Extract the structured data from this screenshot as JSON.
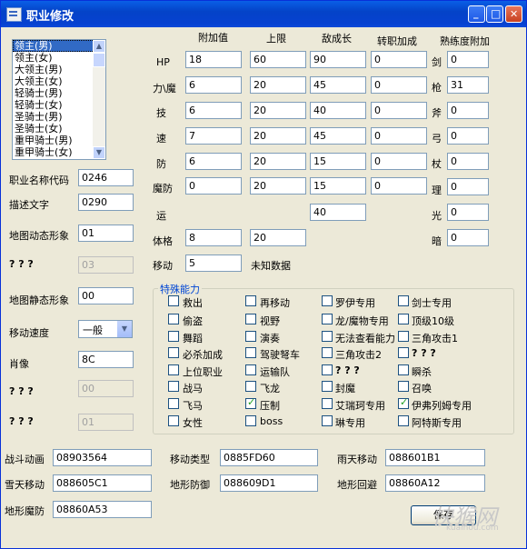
{
  "window": {
    "title": "职业修改",
    "minimize_glyph": "_",
    "maximize_glyph": "□",
    "close_glyph": "✕"
  },
  "class_list": [
    "领主(男)",
    "领主(女)",
    "大领主(男)",
    "大领主(女)",
    "轻骑士(男)",
    "轻骑士(女)",
    "圣骑士(男)",
    "圣骑士(女)",
    "重甲骑士(男)",
    "重甲骑士(女)"
  ],
  "left_fields": {
    "class_code": {
      "label": "职业名称代码",
      "value": "0246"
    },
    "desc_text": {
      "label": "描述文字",
      "value": "0290"
    },
    "map_anim": {
      "label": "地图动态形象",
      "value": "01"
    },
    "unknown1": {
      "label": "? ? ?",
      "value": "03"
    },
    "map_static": {
      "label": "地图静态形象",
      "value": "00"
    },
    "move_speed": {
      "label": "移动速度",
      "value": "一般"
    },
    "portrait": {
      "label": "肖像",
      "value": "8C"
    },
    "unknown2": {
      "label": "? ? ?",
      "value": "00"
    },
    "unknown3": {
      "label": "? ? ?",
      "value": "01"
    }
  },
  "stats": {
    "headers": {
      "bonus": "附加值",
      "cap": "上限",
      "growth": "敌成长",
      "promo": "转职加成",
      "weapon": "熟练度附加"
    },
    "rows": [
      {
        "label": "HP",
        "bonus": "18",
        "cap": "60",
        "growth": "90",
        "promo": "0"
      },
      {
        "label": "力\\魔",
        "bonus": "6",
        "cap": "20",
        "growth": "45",
        "promo": "0"
      },
      {
        "label": "技",
        "bonus": "6",
        "cap": "20",
        "growth": "40",
        "promo": "0"
      },
      {
        "label": "速",
        "bonus": "7",
        "cap": "20",
        "growth": "45",
        "promo": "0"
      },
      {
        "label": "防",
        "bonus": "6",
        "cap": "20",
        "growth": "15",
        "promo": "0"
      },
      {
        "label": "魔防",
        "bonus": "0",
        "cap": "20",
        "growth": "15",
        "promo": "0"
      }
    ],
    "luck": {
      "label": "运",
      "growth": "40"
    },
    "build": {
      "label": "体格",
      "bonus": "8",
      "cap": "20"
    },
    "move": {
      "label": "移动",
      "bonus": "5",
      "note": "未知数据"
    },
    "weapons": [
      {
        "label": "剑",
        "value": "0"
      },
      {
        "label": "枪",
        "value": "31"
      },
      {
        "label": "斧",
        "value": "0"
      },
      {
        "label": "弓",
        "value": "0"
      },
      {
        "label": "杖",
        "value": "0"
      },
      {
        "label": "理",
        "value": "0"
      },
      {
        "label": "光",
        "value": "0"
      },
      {
        "label": "暗",
        "value": "0"
      }
    ]
  },
  "abilities": {
    "title": "特殊能力",
    "items": [
      {
        "label": "救出",
        "checked": false
      },
      {
        "label": "再移动",
        "checked": false
      },
      {
        "label": "罗伊专用",
        "checked": false
      },
      {
        "label": "剑士专用",
        "checked": false
      },
      {
        "label": "偷盗",
        "checked": false
      },
      {
        "label": "视野",
        "checked": false
      },
      {
        "label": "龙/魔物专用",
        "checked": false
      },
      {
        "label": "顶级10级",
        "checked": false
      },
      {
        "label": "舞蹈",
        "checked": false
      },
      {
        "label": "演奏",
        "checked": false
      },
      {
        "label": "无法查看能力",
        "checked": false
      },
      {
        "label": "三角攻击1",
        "checked": false
      },
      {
        "label": "必杀加成",
        "checked": false
      },
      {
        "label": "驾驶弩车",
        "checked": false
      },
      {
        "label": "三角攻击2",
        "checked": false
      },
      {
        "label": "? ? ?",
        "checked": false
      },
      {
        "label": "上位职业",
        "checked": false
      },
      {
        "label": "运输队",
        "checked": false
      },
      {
        "label": "? ? ?",
        "checked": false
      },
      {
        "label": "瞬杀",
        "checked": false
      },
      {
        "label": "战马",
        "checked": false
      },
      {
        "label": "飞龙",
        "checked": false
      },
      {
        "label": "封魔",
        "checked": false
      },
      {
        "label": "召唤",
        "checked": false
      },
      {
        "label": "飞马",
        "checked": false
      },
      {
        "label": "压制",
        "checked": true
      },
      {
        "label": "艾瑞珂专用",
        "checked": false
      },
      {
        "label": "伊弗列姆专用",
        "checked": true
      },
      {
        "label": "女性",
        "checked": false
      },
      {
        "label": "boss",
        "checked": false
      },
      {
        "label": "琳专用",
        "checked": false
      },
      {
        "label": "阿特斯专用",
        "checked": false
      }
    ]
  },
  "bottom": {
    "battle_anim": {
      "label": "战斗动画",
      "value": "08903564"
    },
    "move_type": {
      "label": "移动类型",
      "value": "0885FD60"
    },
    "rain_move": {
      "label": "雨天移动",
      "value": "088601B1"
    },
    "snow_move": {
      "label": "雪天移动",
      "value": "088605C1"
    },
    "terrain_def": {
      "label": "地形防御",
      "value": "088609D1"
    },
    "terrain_avoid": {
      "label": "地形回避",
      "value": "08860A12"
    },
    "terrain_mdef": {
      "label": "地形魔防",
      "value": "08860A53"
    }
  },
  "save_button": "保存",
  "watermark": {
    "main": "快猴网",
    "sub": "kuaihou.com"
  }
}
